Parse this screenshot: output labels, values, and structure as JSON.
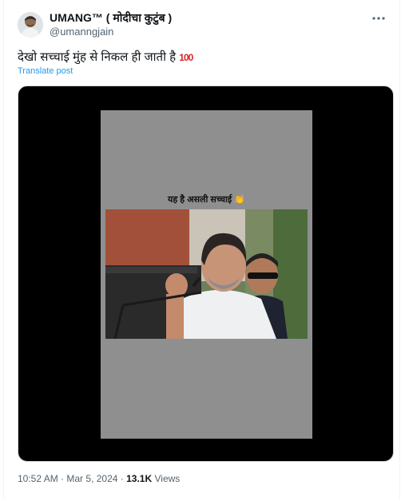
{
  "author": {
    "display_name": "UMANG™ ( मोदीचा कुटुंब )",
    "handle": "@umanngjain"
  },
  "post": {
    "text": "देखो सच्चाई मुंह से निकल ही जाती है",
    "emoji": "100",
    "translate_label": "Translate post"
  },
  "video": {
    "caption": "यह है असली सच्चाई",
    "caption_emoji": "👏"
  },
  "meta": {
    "time": "10:52 AM",
    "date": "Mar 5, 2024",
    "separator": "·",
    "views_count": "13.1K",
    "views_label": "Views"
  },
  "icons": {
    "more": "more-icon"
  },
  "colors": {
    "link": "#1d9bf0",
    "secondary_text": "#536471",
    "primary_text": "#0f1419",
    "hundred_emoji": "#d4252b"
  }
}
